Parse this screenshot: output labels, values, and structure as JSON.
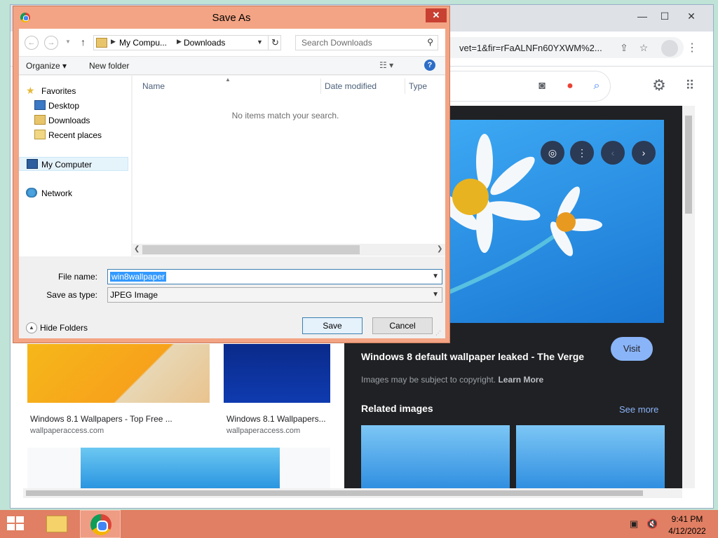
{
  "dialog": {
    "title": "Save As",
    "close": "✕",
    "address": {
      "part1": "My Compu...",
      "part2": "Downloads",
      "sep": "▶"
    },
    "search_placeholder": "Search Downloads",
    "commands": {
      "organize": "Organize ▾",
      "new_folder": "New folder",
      "help": "?"
    },
    "nav": {
      "favorites": "Favorites",
      "desktop": "Desktop",
      "downloads": "Downloads",
      "recent": "Recent places",
      "computer": "My Computer",
      "network": "Network"
    },
    "columns": {
      "name": "Name",
      "date": "Date modified",
      "type": "Type"
    },
    "empty_message": "No items match your search.",
    "file_name_label": "File name:",
    "file_name_value": "win8wallpaper",
    "save_type_label": "Save as type:",
    "save_type_value": "JPEG Image",
    "hide_folders": "Hide Folders",
    "save": "Save",
    "cancel": "Cancel"
  },
  "browser": {
    "url": "vet=1&fir=rFaALNFn60YXWM%2...",
    "results": [
      {
        "caption": "Windows 8.1 Wallpapers - Top Free ...",
        "source": "wallpaperaccess.com"
      },
      {
        "caption": "Windows 8.1 Wallpapers...",
        "source": "wallpaperaccess.com"
      }
    ],
    "panel": {
      "title": "Windows 8 default wallpaper leaked - The Verge",
      "visit": "Visit",
      "copyright": "Images may be subject to copyright.",
      "learn_more": "Learn More",
      "related": "Related images",
      "see_more": "See more"
    }
  },
  "taskbar": {
    "time": "9:41 PM",
    "date": "4/12/2022"
  },
  "colors": {
    "dialog_frame": "#f3a484",
    "taskbar": "#e07f63",
    "close_button": "#c84031",
    "selection": "#3399ff"
  }
}
